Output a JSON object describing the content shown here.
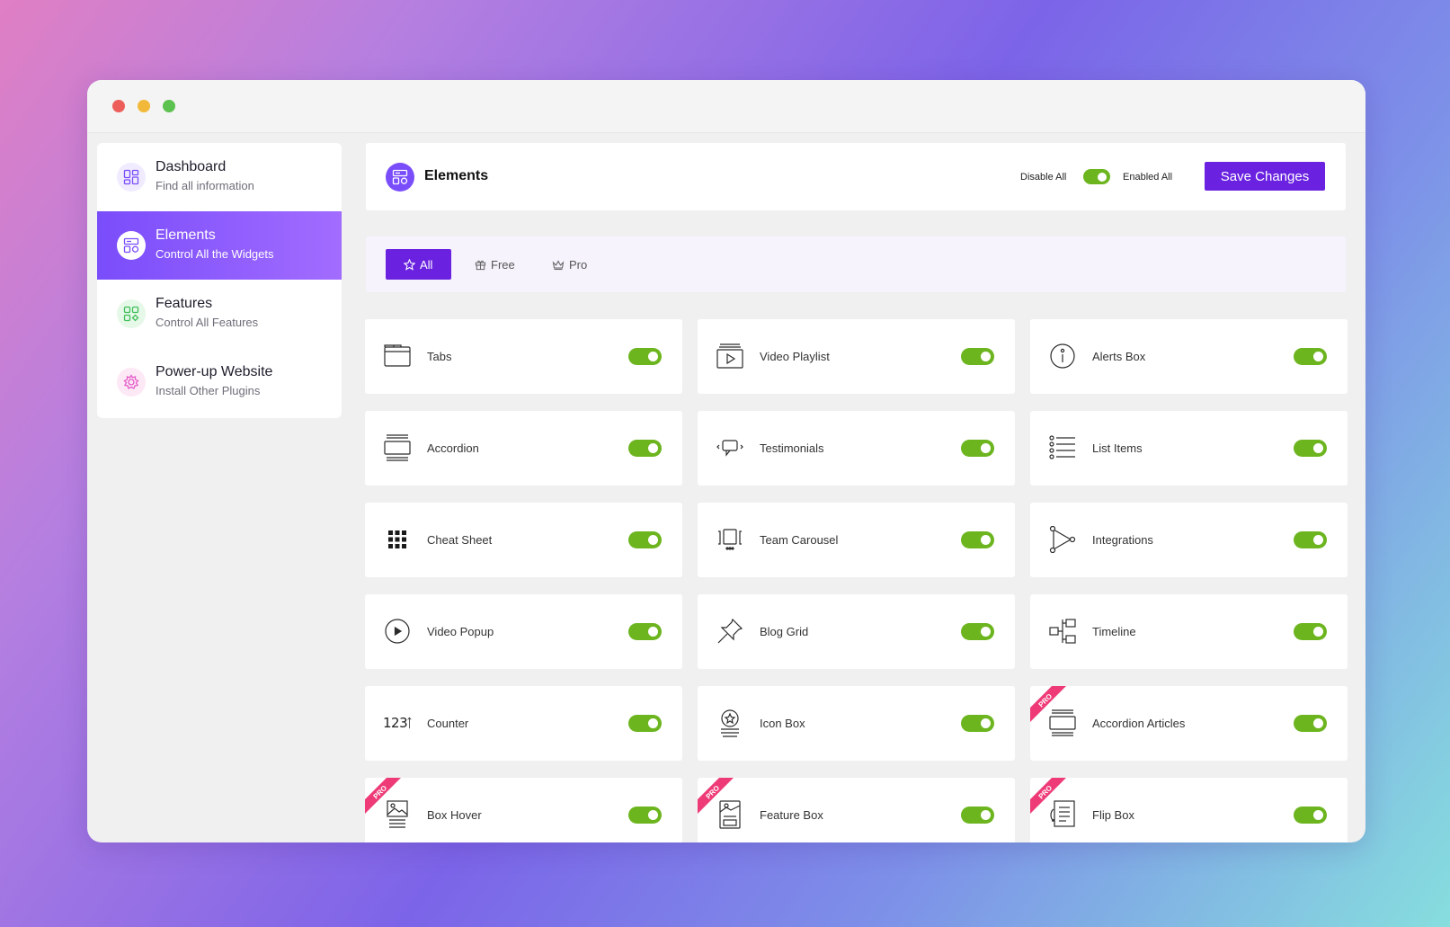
{
  "colors": {
    "accent": "#6a22e0",
    "active_gradient_start": "#7a4dfb",
    "active_gradient_end": "#a26cff",
    "toggle_on": "#6cb51f",
    "pro_badge": "#ee3b78"
  },
  "sidebar": {
    "items": [
      {
        "title": "Dashboard",
        "subtitle": "Find all information",
        "icon": "dashboard-icon"
      },
      {
        "title": "Elements",
        "subtitle": "Control All the Widgets",
        "icon": "elements-icon",
        "active": true
      },
      {
        "title": "Features",
        "subtitle": "Control All Features",
        "icon": "features-icon"
      },
      {
        "title": "Power-up Website",
        "subtitle": "Install Other Plugins",
        "icon": "plugins-icon"
      }
    ]
  },
  "header": {
    "title": "Elements",
    "disable_all": "Disable All",
    "enabled_all": "Enabled All",
    "save_label": "Save Changes",
    "master_toggle_on": true
  },
  "tabs": [
    {
      "label": "All",
      "icon": "star-icon",
      "active": true
    },
    {
      "label": "Free",
      "icon": "gift-icon"
    },
    {
      "label": "Pro",
      "icon": "crown-icon"
    }
  ],
  "widgets": [
    {
      "label": "Tabs",
      "icon": "tabs-icon",
      "enabled": true,
      "pro": false
    },
    {
      "label": "Video Playlist",
      "icon": "video-playlist-icon",
      "enabled": true,
      "pro": false
    },
    {
      "label": "Alerts Box",
      "icon": "info-icon",
      "enabled": true,
      "pro": false
    },
    {
      "label": "Accordion",
      "icon": "accordion-icon",
      "enabled": true,
      "pro": false
    },
    {
      "label": "Testimonials",
      "icon": "testimonial-icon",
      "enabled": true,
      "pro": false
    },
    {
      "label": "List Items",
      "icon": "list-icon",
      "enabled": true,
      "pro": false
    },
    {
      "label": "Cheat Sheet",
      "icon": "grid-dots-icon",
      "enabled": true,
      "pro": false
    },
    {
      "label": "Team Carousel",
      "icon": "carousel-icon",
      "enabled": true,
      "pro": false
    },
    {
      "label": "Integrations",
      "icon": "integrations-icon",
      "enabled": true,
      "pro": false
    },
    {
      "label": "Video Popup",
      "icon": "play-circle-icon",
      "enabled": true,
      "pro": false
    },
    {
      "label": "Blog Grid",
      "icon": "pin-icon",
      "enabled": true,
      "pro": false
    },
    {
      "label": "Timeline",
      "icon": "timeline-icon",
      "enabled": true,
      "pro": false
    },
    {
      "label": "Counter",
      "icon": "counter-icon",
      "counter_text": "123",
      "enabled": true,
      "pro": false
    },
    {
      "label": "Icon Box",
      "icon": "icon-box-icon",
      "enabled": true,
      "pro": false
    },
    {
      "label": "Accordion Articles",
      "icon": "accordion-icon",
      "enabled": true,
      "pro": true
    },
    {
      "label": "Box Hover",
      "icon": "image-box-icon",
      "enabled": true,
      "pro": true
    },
    {
      "label": "Feature Box",
      "icon": "feature-box-icon",
      "enabled": true,
      "pro": true
    },
    {
      "label": "Flip Box",
      "icon": "flip-box-icon",
      "enabled": true,
      "pro": true
    }
  ],
  "pro_badge_text": "PRO"
}
